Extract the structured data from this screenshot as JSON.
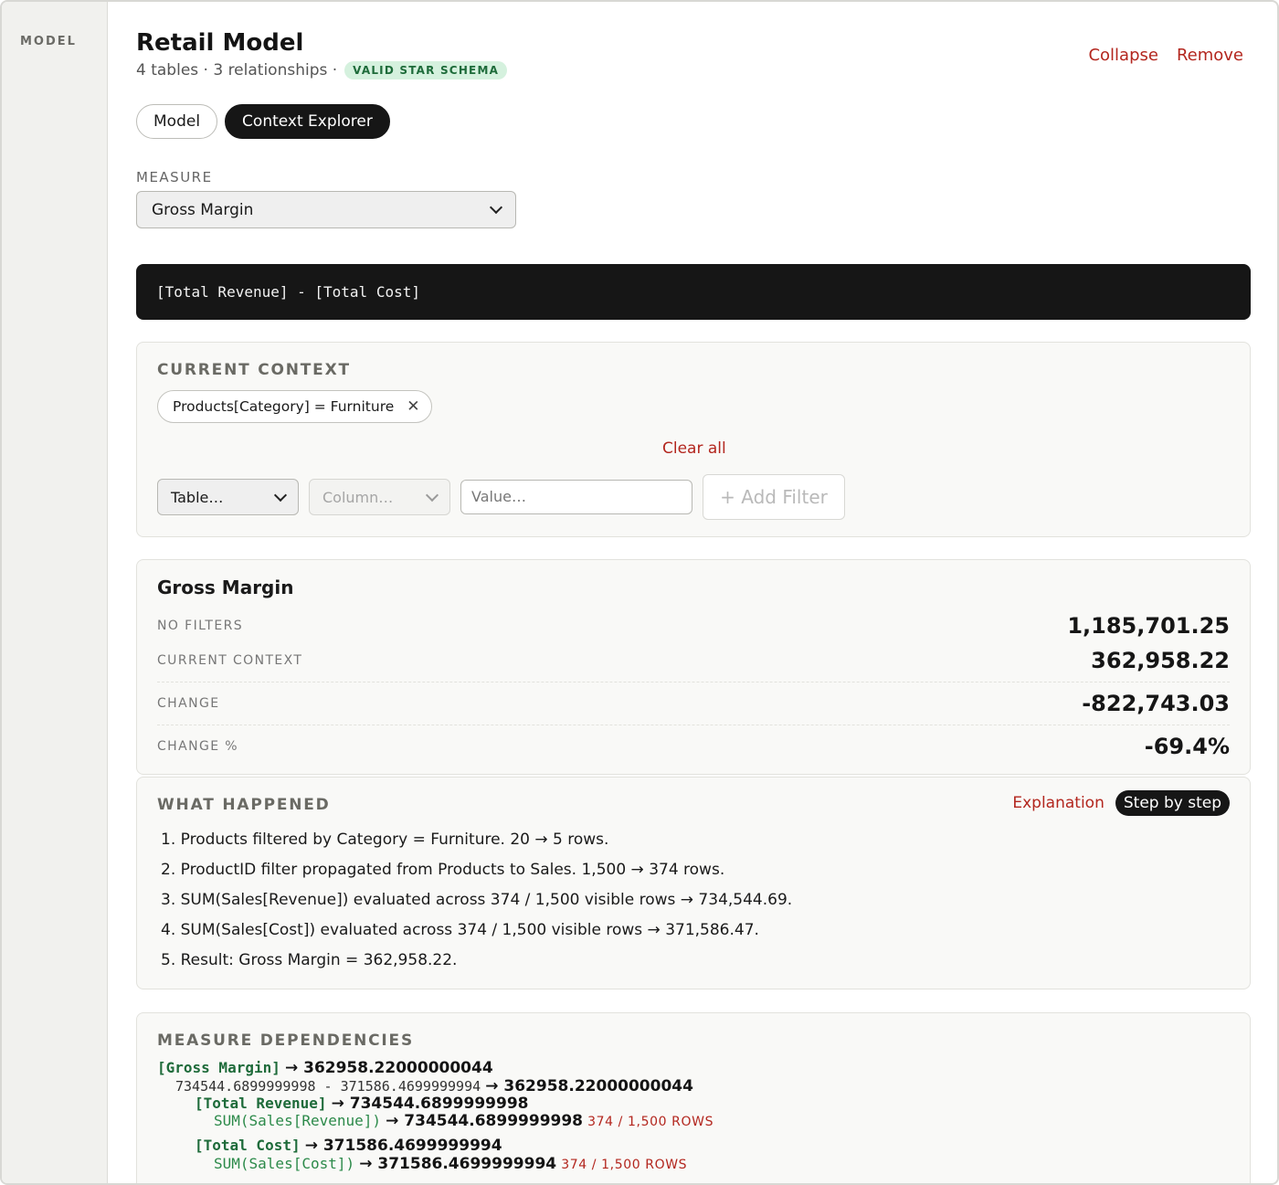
{
  "sidebar": {
    "label": "MODEL"
  },
  "header": {
    "title": "Retail Model",
    "subtitle": "4 tables · 3 relationships ·",
    "badge": "VALID STAR SCHEMA",
    "collapse": "Collapse",
    "remove": "Remove"
  },
  "tabs": [
    {
      "label": "Model",
      "active": false
    },
    {
      "label": "Context Explorer",
      "active": true
    }
  ],
  "measure": {
    "label": "MEASURE",
    "selected": "Gross Margin",
    "formula": "[Total Revenue] - [Total Cost]"
  },
  "context": {
    "title": "CURRENT CONTEXT",
    "chip": "Products[Category] = Furniture",
    "clear_all": "Clear all",
    "table_select": "Table…",
    "column_select": "Column…",
    "value_placeholder": "Value…",
    "add_filter": "+ Add Filter"
  },
  "result": {
    "title": "Gross Margin",
    "rows": [
      {
        "label": "NO FILTERS",
        "value": "1,185,701.25"
      },
      {
        "label": "CURRENT CONTEXT",
        "value": "362,958.22"
      },
      {
        "label": "CHANGE",
        "value": "-822,743.03"
      },
      {
        "label": "CHANGE %",
        "value": "-69.4%"
      }
    ]
  },
  "what_happened": {
    "title": "WHAT HAPPENED",
    "explanation": "Explanation",
    "step_by_step": "Step by step",
    "steps": [
      "1. Products filtered by Category = Furniture. 20 → 5 rows.",
      "2. ProductID filter propagated from Products to Sales. 1,500 → 374 rows.",
      "3. SUM(Sales[Revenue]) evaluated across 374 / 1,500 visible rows → 734,544.69.",
      "4. SUM(Sales[Cost]) evaluated across 374 / 1,500 visible rows → 371,586.47.",
      "5. Result: Gross Margin = 362,958.22."
    ]
  },
  "dependencies": {
    "title": "MEASURE DEPENDENCIES",
    "gm_name": "[Gross Margin]",
    "gm_value": "→ 362958.22000000044",
    "expr": "734544.6899999998 - 371586.4699999994",
    "expr_value": "→ 362958.22000000044",
    "rev_name": "[Total Revenue]",
    "rev_value": "→ 734544.6899999998",
    "rev_sum": "SUM(Sales[Revenue])",
    "rev_sum_value": "→ 734544.6899999998",
    "rev_rows": "374 / 1,500 ROWS",
    "cost_name": "[Total Cost]",
    "cost_value": "→ 371586.4699999994",
    "cost_sum": "SUM(Sales[Cost])",
    "cost_sum_value": "→ 371586.4699999994",
    "cost_rows": "374 / 1,500 ROWS"
  }
}
